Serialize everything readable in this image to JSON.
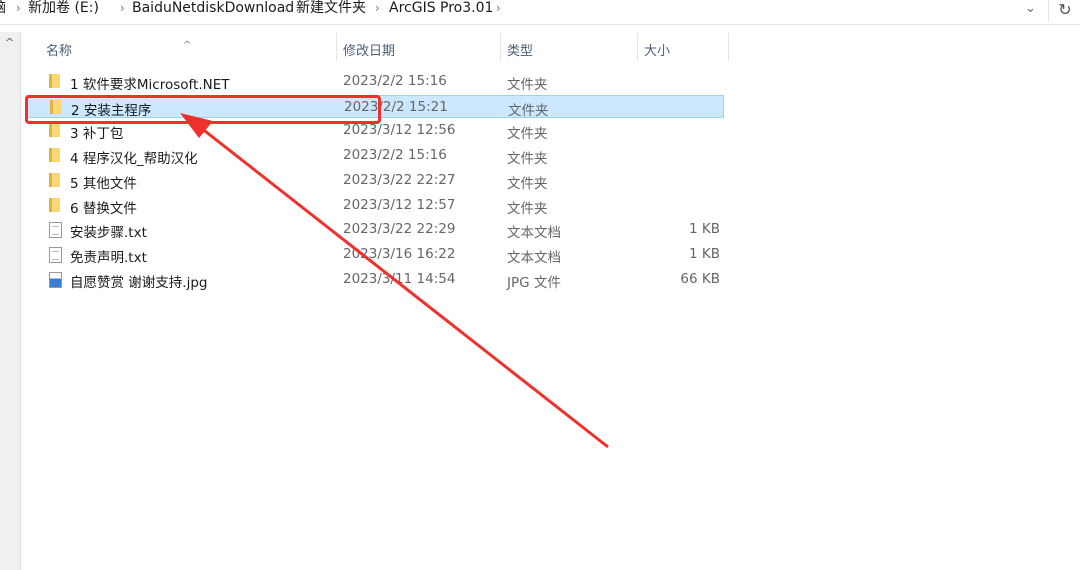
{
  "breadcrumb": {
    "items": [
      "脑",
      "新加卷 (E:)",
      "BaiduNetdiskDownload",
      "新建文件夹",
      "ArcGIS Pro3.01"
    ]
  },
  "columns": {
    "name": "名称",
    "date": "修改日期",
    "type": "类型",
    "size": "大小"
  },
  "files": [
    {
      "name": "1 软件要求Microsoft.NET",
      "date": "2023/2/2 15:16",
      "type": "文件夹",
      "size": "",
      "kind": "folder"
    },
    {
      "name": "2 安装主程序",
      "date": "2023/2/2 15:21",
      "type": "文件夹",
      "size": "",
      "kind": "folder",
      "selected": true
    },
    {
      "name": "3 补丁包",
      "date": "2023/3/12 12:56",
      "type": "文件夹",
      "size": "",
      "kind": "folder"
    },
    {
      "name": "4 程序汉化_帮助汉化",
      "date": "2023/2/2 15:16",
      "type": "文件夹",
      "size": "",
      "kind": "folder"
    },
    {
      "name": "5 其他文件",
      "date": "2023/3/22 22:27",
      "type": "文件夹",
      "size": "",
      "kind": "folder"
    },
    {
      "name": "6 替换文件",
      "date": "2023/3/12 12:57",
      "type": "文件夹",
      "size": "",
      "kind": "folder"
    },
    {
      "name": "安装步骤.txt",
      "date": "2023/3/22 22:29",
      "type": "文本文档",
      "size": "1 KB",
      "kind": "file"
    },
    {
      "name": "免责声明.txt",
      "date": "2023/3/16 16:22",
      "type": "文本文档",
      "size": "1 KB",
      "kind": "file"
    },
    {
      "name": "自愿赞赏 谢谢支持.jpg",
      "date": "2023/3/11 14:54",
      "type": "JPG 文件",
      "size": "66 KB",
      "kind": "img"
    }
  ],
  "colors": {
    "selection": "#cce8ff",
    "annotation": "#f0302a"
  }
}
